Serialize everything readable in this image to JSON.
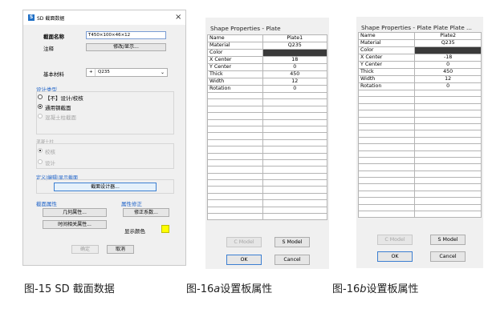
{
  "sd_dialog": {
    "title": "SD 截面数据",
    "close": "×",
    "name_label": "截面名称",
    "name_value": "T450×100×46×12",
    "note_label": "注释",
    "note_button": "修改/显示...",
    "material_label": "基本材料",
    "material_prefix": "+",
    "material_value": "Q235",
    "design_type_label": "设计类型",
    "design_options": [
      "【不】设计/校核",
      "通用钢截面",
      "混凝土柱截面"
    ],
    "concrete_col_label": "混凝土柱",
    "concrete_options": [
      "校核",
      "设计"
    ],
    "define_label": "定义|编辑|显示截面",
    "designer_button": "截面设计器...",
    "section_props_label": "截面属性",
    "geometry_button": "几何属性...",
    "time_button": "时间相关属性...",
    "props_modify_label": "属性修正",
    "modify_button": "修正系数...",
    "display_color_label": "显示颜色",
    "display_color": "#ffff00",
    "ok_button": "确定",
    "cancel_button": "取消"
  },
  "shape_a": {
    "title": "Shape Properties - Plate",
    "rows": [
      {
        "name": "Name",
        "value": "Plate1"
      },
      {
        "name": "Material",
        "value": "Q235"
      },
      {
        "name": "Color",
        "value": ""
      },
      {
        "name": "X Center",
        "value": "18"
      },
      {
        "name": "Y Center",
        "value": "0"
      },
      {
        "name": "Thick",
        "value": "450"
      },
      {
        "name": "Width",
        "value": "12"
      },
      {
        "name": "Rotation",
        "value": "0"
      }
    ],
    "c_model": "C Model",
    "s_model": "S Model",
    "ok": "OK",
    "cancel": "Cancel"
  },
  "shape_b": {
    "title": "Shape Properties - Plate Plate Plate ...",
    "rows": [
      {
        "name": "Name",
        "value": "Plate2"
      },
      {
        "name": "Material",
        "value": "Q235"
      },
      {
        "name": "Color",
        "value": ""
      },
      {
        "name": "X Center",
        "value": "-18"
      },
      {
        "name": "Y Center",
        "value": "0"
      },
      {
        "name": "Thick",
        "value": "450"
      },
      {
        "name": "Width",
        "value": "12"
      },
      {
        "name": "Rotation",
        "value": "0"
      }
    ],
    "c_model": "C Model",
    "s_model": "S Model",
    "ok": "OK",
    "cancel": "Cancel"
  },
  "captions": {
    "fig15": "图-15 SD 截面数据",
    "fig16a_pre": "图-16",
    "fig16a_letter": "a",
    "fig16a_post": "设置板属性",
    "fig16b_pre": "图-16",
    "fig16b_letter": "b",
    "fig16b_post": "设置板属性"
  },
  "colors": {
    "color_cell": "#3a3a3a",
    "accent": "#1f63c8"
  }
}
